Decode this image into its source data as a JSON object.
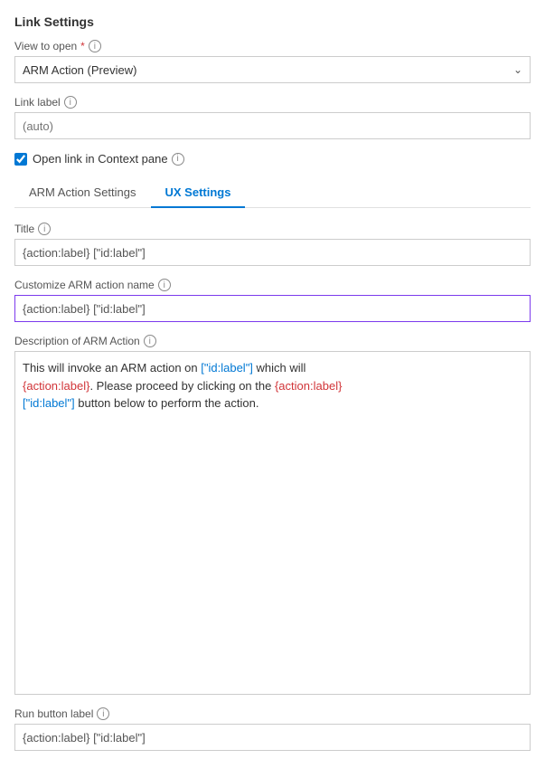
{
  "header": {
    "title": "Link Settings"
  },
  "view_to_open": {
    "label": "View to open",
    "required": true,
    "value": "ARM Action (Preview)"
  },
  "link_label": {
    "label": "Link label",
    "placeholder": "(auto)"
  },
  "open_in_context": {
    "label": "Open link in Context pane",
    "checked": true
  },
  "tabs": [
    {
      "label": "ARM Action Settings",
      "active": false
    },
    {
      "label": "UX Settings",
      "active": true
    }
  ],
  "title_field": {
    "label": "Title",
    "value": "{action:label} [\"id:label\"]"
  },
  "customize_arm": {
    "label": "Customize ARM action name",
    "value": "{action:label} [\"id:label\"]"
  },
  "description": {
    "label": "Description of ARM Action",
    "line1_plain": "This will invoke an ARM action on ",
    "line1_blue": "[\"id:label\"]",
    "line1_plain2": " which will",
    "line2_red": "{action:label}",
    "line2_plain": ". Please proceed by clicking on the ",
    "line2_red2": "{action:label}",
    "line3_blue": "[\"id:label\"]",
    "line3_plain": " button below to perform the action."
  },
  "run_button_label": {
    "label": "Run button label",
    "value": "{action:label} [\"id:label\"]"
  },
  "icons": {
    "info": "i",
    "chevron_down": "∨"
  },
  "colors": {
    "accent_blue": "#0078d4",
    "red": "#d13438",
    "purple": "#7c3aed"
  }
}
